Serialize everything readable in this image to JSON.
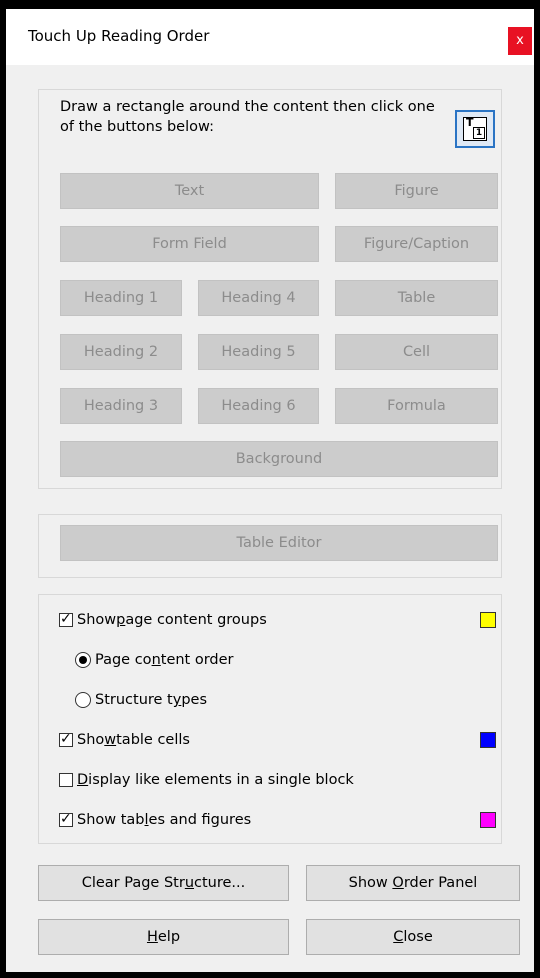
{
  "window": {
    "title": "Touch Up Reading Order",
    "close_glyph": "x"
  },
  "instructions": "Draw a rectangle around the content then click one of the buttons below:",
  "tag_buttons": {
    "text": "Text",
    "figure": "Figure",
    "form_field": "Form Field",
    "figure_caption": "Figure/Caption",
    "heading1": "Heading 1",
    "heading4": "Heading 4",
    "table": "Table",
    "heading2": "Heading 2",
    "heading5": "Heading 5",
    "cell": "Cell",
    "heading3": "Heading 3",
    "heading6": "Heading 6",
    "formula": "Formula",
    "background": "Background"
  },
  "table_editor": "Table Editor",
  "options": {
    "show_groups": {
      "pre": "Show ",
      "u": "p",
      "post": "age content groups",
      "checked": true,
      "color": "#ffff00"
    },
    "page_content_order": {
      "pre": "Page co",
      "u": "n",
      "post": "tent order",
      "selected": true
    },
    "structure_types": {
      "pre": "Structure t",
      "u": "y",
      "post": "pes",
      "selected": false
    },
    "show_cells": {
      "pre": "Sho",
      "u": "w",
      "post": " table cells",
      "checked": true,
      "color": "#0000ff"
    },
    "display_like": {
      "pre": "",
      "u": "D",
      "post": "isplay like elements in a single block",
      "checked": false
    },
    "show_tables_figures": {
      "pre": "Show tab",
      "u": "l",
      "post": "es and figures",
      "checked": true,
      "color": "#ff00ff"
    }
  },
  "bottom_buttons": {
    "clear": {
      "pre": "Clear Page Str",
      "u": "u",
      "post": "cture..."
    },
    "order_panel": {
      "pre": "Show ",
      "u": "O",
      "post": "rder Panel"
    },
    "help": {
      "pre": "",
      "u": "H",
      "post": "elp"
    },
    "close": {
      "pre": "",
      "u": "C",
      "post": "lose"
    }
  },
  "check_glyph": "✓"
}
